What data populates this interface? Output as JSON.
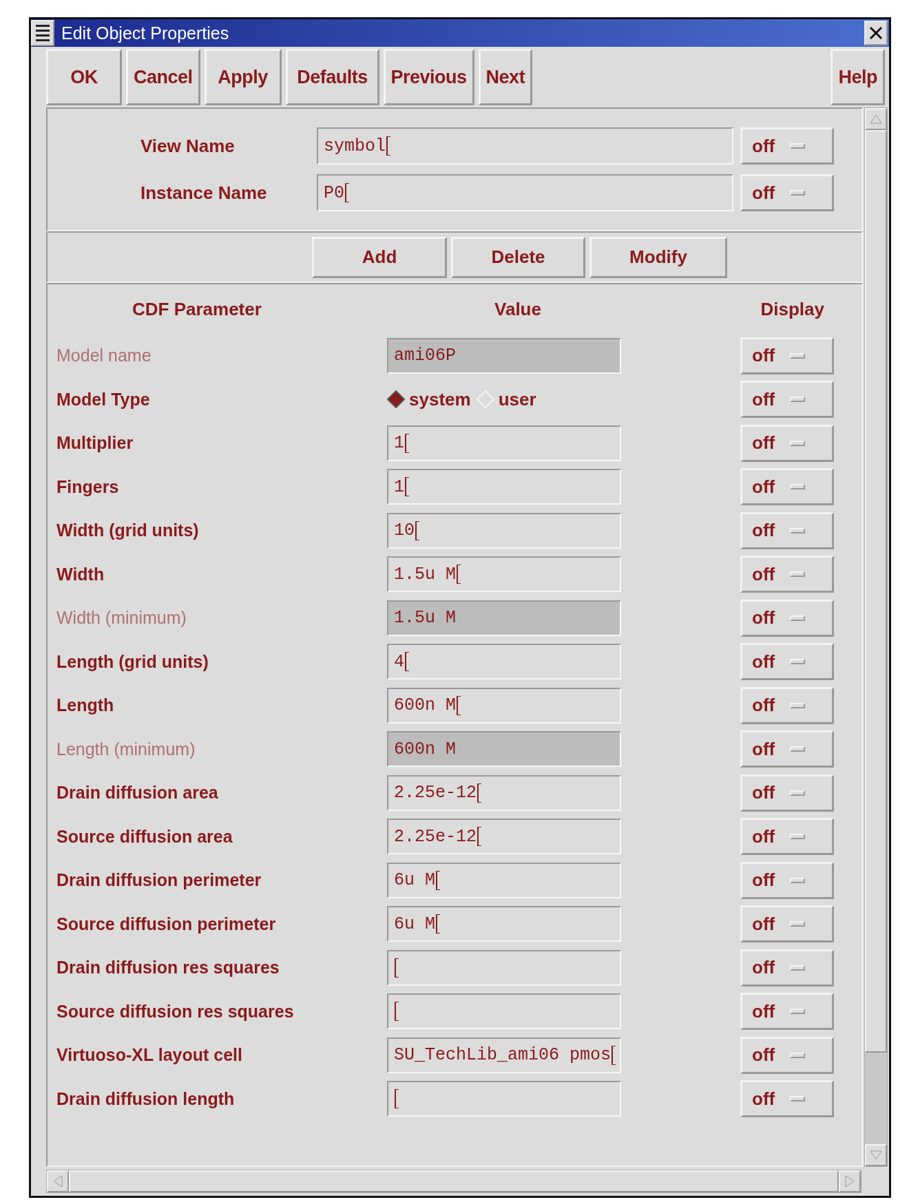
{
  "window": {
    "title": "Edit Object Properties"
  },
  "toolbar": {
    "buttons": [
      "OK",
      "Cancel",
      "Apply",
      "Defaults",
      "Previous",
      "Next"
    ],
    "help": "Help"
  },
  "name_fields": [
    {
      "label": "View Name",
      "value": "symbol",
      "display": "off"
    },
    {
      "label": "Instance Name",
      "value": "P0",
      "display": "off"
    }
  ],
  "actions": [
    "Add",
    "Delete",
    "Modify"
  ],
  "table": {
    "columns": [
      "CDF Parameter",
      "Value",
      "Display"
    ],
    "rows": [
      {
        "kind": "field",
        "label": "Model name",
        "value": "ami06P",
        "disabled": true,
        "display": "off"
      },
      {
        "kind": "radio",
        "label": "Model Type",
        "options": [
          {
            "label": "system",
            "selected": true
          },
          {
            "label": "user",
            "selected": false
          }
        ],
        "disabled": false,
        "display": "off"
      },
      {
        "kind": "field",
        "label": "Multiplier",
        "value": "1",
        "disabled": false,
        "display": "off"
      },
      {
        "kind": "field",
        "label": "Fingers",
        "value": "1",
        "disabled": false,
        "display": "off"
      },
      {
        "kind": "field",
        "label": "Width (grid units)",
        "value": "10",
        "disabled": false,
        "display": "off"
      },
      {
        "kind": "field",
        "label": "Width",
        "value": "1.5u M",
        "disabled": false,
        "display": "off"
      },
      {
        "kind": "field",
        "label": "Width (minimum)",
        "value": "1.5u M",
        "disabled": true,
        "display": "off"
      },
      {
        "kind": "field",
        "label": "Length (grid units)",
        "value": "4",
        "disabled": false,
        "display": "off"
      },
      {
        "kind": "field",
        "label": "Length",
        "value": "600n M",
        "disabled": false,
        "display": "off"
      },
      {
        "kind": "field",
        "label": "Length (minimum)",
        "value": "600n M",
        "disabled": true,
        "display": "off"
      },
      {
        "kind": "field",
        "label": "Drain diffusion area",
        "value": "2.25e-12",
        "disabled": false,
        "display": "off"
      },
      {
        "kind": "field",
        "label": "Source diffusion area",
        "value": "2.25e-12",
        "disabled": false,
        "display": "off"
      },
      {
        "kind": "field",
        "label": "Drain diffusion perimeter",
        "value": "6u M",
        "disabled": false,
        "display": "off"
      },
      {
        "kind": "field",
        "label": "Source diffusion perimeter",
        "value": "6u M",
        "disabled": false,
        "display": "off"
      },
      {
        "kind": "field",
        "label": "Drain diffusion res squares",
        "disabled": false,
        "display": "off"
      },
      {
        "kind": "field",
        "label": "Source diffusion res squares",
        "disabled": false,
        "display": "off"
      },
      {
        "kind": "field",
        "label": "Virtuoso-XL layout cell",
        "value": "SU_TechLib_ami06 pmos",
        "disabled": false,
        "display": "off"
      },
      {
        "kind": "field",
        "label": "Drain diffusion length",
        "disabled": false,
        "display": "off"
      }
    ]
  }
}
